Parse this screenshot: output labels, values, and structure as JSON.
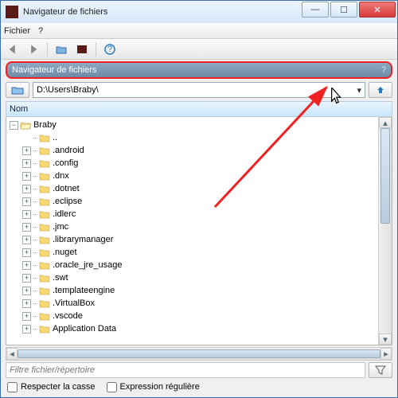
{
  "window": {
    "title": "Navigateur de fichiers"
  },
  "menu": {
    "file": "Fichier",
    "help": "?"
  },
  "banner": {
    "text": "Navigateur de fichiers",
    "help": "?"
  },
  "path": {
    "value": "D:\\Users\\Braby\\"
  },
  "columns": {
    "name": "Nom"
  },
  "tree": {
    "root": "Braby",
    "up": "..",
    "items": [
      ".android",
      ".config",
      ".dnx",
      ".dotnet",
      ".eclipse",
      ".idlerc",
      ".jmc",
      ".librarymanager",
      ".nuget",
      ".oracle_jre_usage",
      ".swt",
      ".templateengine",
      ".VirtualBox",
      ".vscode",
      "Application Data"
    ]
  },
  "filter": {
    "placeholder": "Filtre fichier/répertoire"
  },
  "options": {
    "case": "Respecter la casse",
    "regex": "Expression régulière"
  }
}
